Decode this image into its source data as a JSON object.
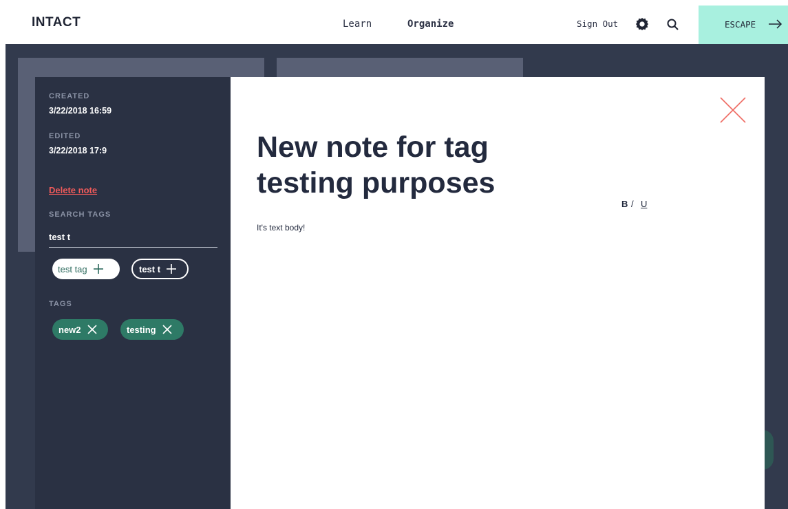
{
  "app": {
    "logo": "INTACT"
  },
  "nav": {
    "learn": "Learn",
    "organize": "Organize",
    "sign_out": "Sign Out",
    "escape": "ESCAPE"
  },
  "sidebar": {
    "created_label": "CREATED",
    "created_value": "3/22/2018 16:59",
    "edited_label": "EDITED",
    "edited_value": "3/22/2018 17:9",
    "delete": "Delete note",
    "search_tags_label": "SEARCH TAGS",
    "search_value": "test t",
    "suggestions": [
      "test tag",
      "test t"
    ],
    "tags_label": "TAGS",
    "tags": [
      "new2",
      "testing"
    ]
  },
  "note": {
    "title": "New note for tag testing purposes",
    "format": {
      "bold": "B",
      "sep": "/",
      "underline": "U",
      "italic_note": ""
    },
    "body": "It's text body!"
  },
  "colors": {
    "escape_bg": "#a8f0df",
    "backdrop": "#323a4d",
    "sidebar": "#2a3143",
    "tag_green": "#2e7a66",
    "danger": "#ef5a5a"
  },
  "icons": [
    "gear-icon",
    "search-icon",
    "arrow-right-icon",
    "close-icon",
    "plus-icon",
    "x-icon"
  ]
}
